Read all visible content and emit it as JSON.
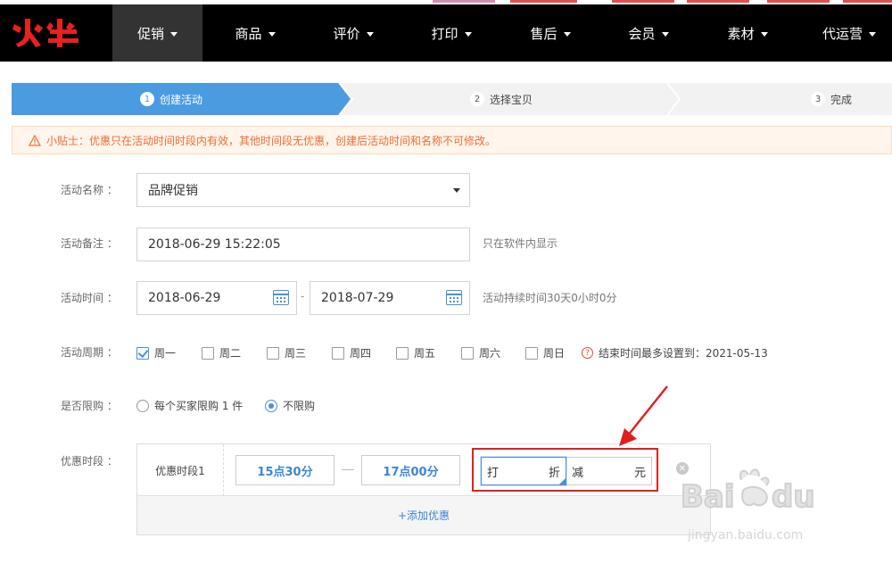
{
  "nav": {
    "logo_text": "火牛",
    "items": [
      {
        "label": "促销",
        "active": true
      },
      {
        "label": "商品"
      },
      {
        "label": "评价"
      },
      {
        "label": "打印"
      },
      {
        "label": "售后"
      },
      {
        "label": "会员"
      },
      {
        "label": "素材"
      },
      {
        "label": "代运营"
      }
    ]
  },
  "steps": [
    {
      "num": "1",
      "label": "创建活动",
      "active": true
    },
    {
      "num": "2",
      "label": "选择宝贝"
    },
    {
      "num": "3",
      "label": "完成"
    }
  ],
  "tip": {
    "text": "小贴士：优惠只在活动时间时段内有效，其他时间段无优惠，创建后活动时间和名称不可修改。"
  },
  "form": {
    "name": {
      "label": "活动名称 ：",
      "value": "品牌促销"
    },
    "note": {
      "label": "活动备注 ：",
      "value": "2018-06-29 15:22:05",
      "hint": "只在软件内显示"
    },
    "time": {
      "label": "活动时间 ：",
      "start": "2018-06-29",
      "end": "2018-07-29",
      "separator": "-",
      "hint": "活动持续时间30天0小时0分"
    },
    "cycle": {
      "label": "活动周期 ：",
      "days": [
        {
          "label": "周一",
          "checked": true
        },
        {
          "label": "周二",
          "checked": false
        },
        {
          "label": "周三",
          "checked": false
        },
        {
          "label": "周四",
          "checked": false
        },
        {
          "label": "周五",
          "checked": false
        },
        {
          "label": "周六",
          "checked": false
        },
        {
          "label": "周日",
          "checked": false
        }
      ],
      "end_hint": "结束时间最多设置到：2021-05-13"
    },
    "limit": {
      "label": "是否限购 ：",
      "options": [
        {
          "label": "每个买家限购 1 件",
          "selected": false
        },
        {
          "label": "不限购",
          "selected": true
        }
      ]
    },
    "period": {
      "label": "优惠时段 ：",
      "row_label": "优惠时段1",
      "start": "15点30分",
      "end": "17点00分",
      "discount_prefix": "打",
      "discount_suffix": "折",
      "reduce_prefix": "减",
      "reduce_suffix": "元",
      "add_label": "+添加优惠"
    }
  },
  "colors": {
    "accent": "#4a9be0",
    "warning": "#f06d30",
    "highlight": "#e02020"
  }
}
